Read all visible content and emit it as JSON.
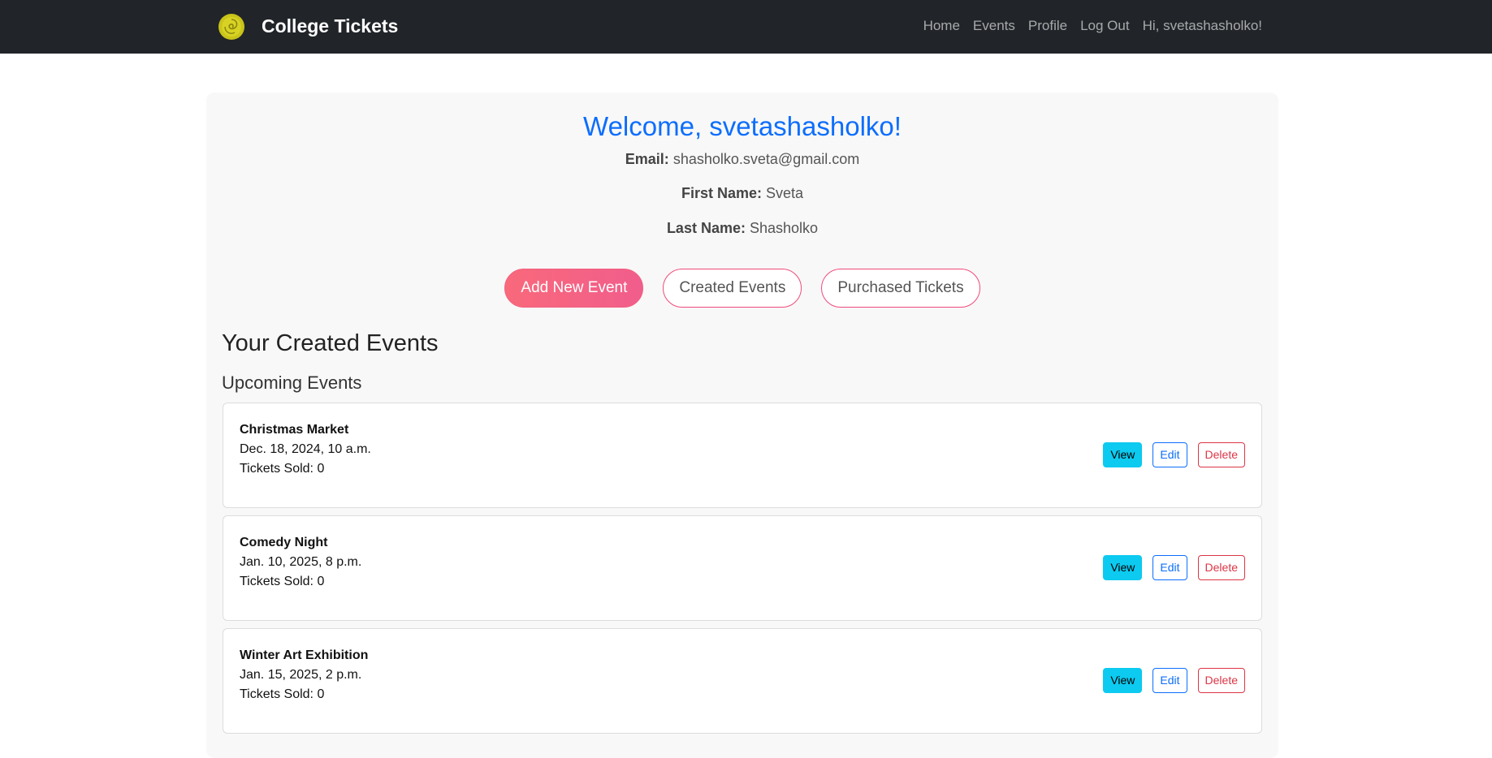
{
  "navbar": {
    "brand": "College Tickets",
    "links": [
      "Home",
      "Events",
      "Profile",
      "Log Out"
    ],
    "greeting": "Hi, svetashasholko!"
  },
  "profile": {
    "welcome": "Welcome, svetashasholko!",
    "email_label": "Email:",
    "email": "shasholko.sveta@gmail.com",
    "first_name_label": "First Name:",
    "first_name": "Sveta",
    "last_name_label": "Last Name:",
    "last_name": "Shasholko"
  },
  "buttons": {
    "add_new_event": "Add New Event",
    "created_events": "Created Events",
    "purchased_tickets": "Purchased Tickets"
  },
  "sections": {
    "created_heading": "Your Created Events",
    "upcoming_heading": "Upcoming Events"
  },
  "events": [
    {
      "name": "Christmas Market",
      "date": "Dec. 18, 2024, 10 a.m.",
      "sold": "Tickets Sold: 0"
    },
    {
      "name": "Comedy Night",
      "date": "Jan. 10, 2025, 8 p.m.",
      "sold": "Tickets Sold: 0"
    },
    {
      "name": "Winter Art Exhibition",
      "date": "Jan. 15, 2025, 2 p.m.",
      "sold": "Tickets Sold: 0"
    }
  ],
  "event_actions": {
    "view": "View",
    "edit": "Edit",
    "delete": "Delete"
  },
  "colors": {
    "navbar_bg": "#212529",
    "welcome": "#0d6efd",
    "accent_pink": "#f15d8c",
    "view_btn": "#0dcaf0",
    "edit_btn": "#0d6efd",
    "delete_btn": "#dc3545"
  },
  "icons": {
    "logo": "yellow-swirl-logo-icon"
  }
}
